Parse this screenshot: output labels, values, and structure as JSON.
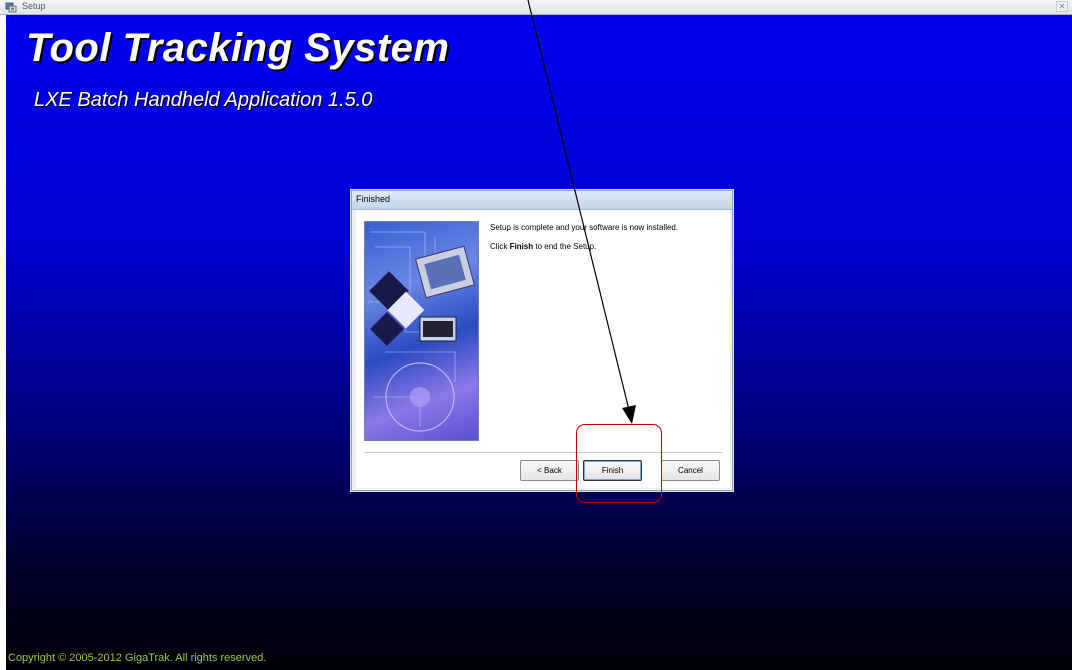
{
  "window": {
    "title": "Setup",
    "close_glyph": "✕"
  },
  "app": {
    "heading": "Tool Tracking System",
    "subheading": "LXE Batch Handheld Application 1.5.0",
    "copyright": "Copyright © 2005-2012 GigaTrak. All rights reserved."
  },
  "dialog": {
    "title": "Finished",
    "message_1": "Setup is complete and your software is now installed.",
    "message_2_prefix": "Click ",
    "message_2_bold": "Finish",
    "message_2_suffix": " to end the Setup.",
    "buttons": {
      "back": "< Back",
      "finish": "Finish",
      "cancel": "Cancel"
    }
  },
  "colors": {
    "background_top": "#0000ee",
    "background_bottom": "#000008",
    "copyright_text": "#9acd32",
    "annotation": "#c00000"
  },
  "icons": {
    "app_icon": "setup-app-icon",
    "close_icon": "close-icon",
    "annotation_arrow": "arrow-pointer-icon"
  }
}
